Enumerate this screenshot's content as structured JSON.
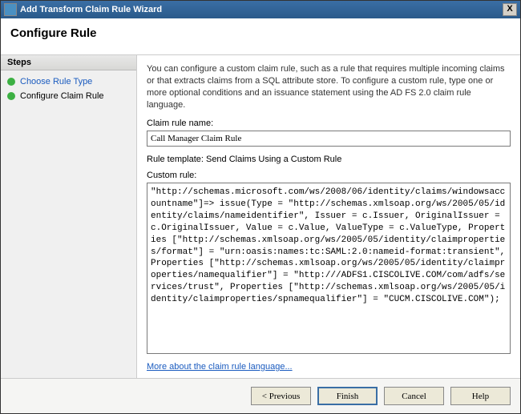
{
  "window": {
    "title": "Add Transform Claim Rule Wizard",
    "close_symbol": "X"
  },
  "header": {
    "title": "Configure Rule"
  },
  "sidebar": {
    "title": "Steps",
    "items": [
      {
        "label": "Choose Rule Type",
        "state": "completed"
      },
      {
        "label": "Configure Claim Rule",
        "state": "current"
      }
    ]
  },
  "main": {
    "description": "You can configure a custom claim rule, such as a rule that requires multiple incoming claims or that extracts claims from a SQL attribute store. To configure a custom rule, type one or more optional conditions and an issuance statement using the AD FS 2.0 claim rule language.",
    "claim_rule_name_label": "Claim rule name:",
    "claim_rule_name_value": "Call Manager Claim Rule",
    "rule_template_label": "Rule template: Send Claims Using a Custom Rule",
    "custom_rule_label": "Custom rule:",
    "custom_rule_value": "\"http://schemas.microsoft.com/ws/2008/06/identity/claims/windowsaccountname\"]=> issue(Type = \"http://schemas.xmlsoap.org/ws/2005/05/identity/claims/nameidentifier\", Issuer = c.Issuer, OriginalIssuer = c.OriginalIssuer, Value = c.Value, ValueType = c.ValueType, Properties [\"http://schemas.xmlsoap.org/ws/2005/05/identity/claimproperties/format\"] = \"urn:oasis:names:tc:SAML:2.0:nameid-format:transient\", Properties [\"http://schemas.xmlsoap.org/ws/2005/05/identity/claimproperties/namequalifier\"] = \"http:///ADFS1.CISCOLIVE.COM/com/adfs/services/trust\", Properties [\"http://schemas.xmlsoap.org/ws/2005/05/identity/claimproperties/spnamequalifier\"] = \"CUCM.CISCOLIVE.COM\");",
    "help_link": "More about the claim rule language..."
  },
  "footer": {
    "previous": "< Previous",
    "finish": "Finish",
    "cancel": "Cancel",
    "help": "Help"
  }
}
